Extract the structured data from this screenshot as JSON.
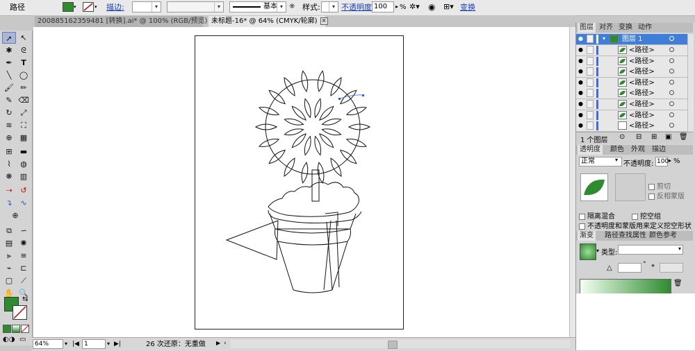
{
  "control_bar": {
    "object_type": "路径",
    "fill_color": "#2e8b2e",
    "stroke_label": "描边:",
    "stroke_profile_label": "基本",
    "style_label": "样式:",
    "opacity_label": "不透明度:",
    "opacity_value": "100",
    "percent": "%",
    "transform_label": "变换"
  },
  "tabs": [
    {
      "label": "200885162359481 [转换].ai* @ 100% (RGB/预览)",
      "active": false
    },
    {
      "label": "未标题-16* @ 64% (CMYK/轮廓)",
      "active": true
    }
  ],
  "status_bar": {
    "zoom": "64%",
    "artboard": "1",
    "undo_text": "26 次还原：无重做"
  },
  "panel_layers": {
    "tabs": [
      "图层",
      "对齐",
      "变换",
      "动作"
    ],
    "layer_name": "图层 1",
    "rows": [
      {
        "label": "<路径>"
      },
      {
        "label": "<路径>"
      },
      {
        "label": "<路径>"
      },
      {
        "label": "<路径>"
      },
      {
        "label": "<路径>"
      },
      {
        "label": "<路径>"
      },
      {
        "label": "<路径>"
      },
      {
        "label": "<路径>"
      }
    ],
    "count": "1 个图层"
  },
  "panel_transparency": {
    "tabs": [
      "透明度",
      "颜色",
      "外观",
      "描边"
    ],
    "blend_mode": "正常",
    "opacity_label": "不透明度:",
    "opacity_value": "100",
    "percent": "%",
    "clip_label": "剪切",
    "invert_label": "反相蒙版",
    "isolate_label": "隔离混合",
    "knockout_label": "挖空组",
    "opacity_mask_label": "不透明度和蒙版用来定义挖空形状"
  },
  "panel_gradient": {
    "tabs": [
      "渐变",
      "路径查找",
      "属性",
      "颜色参考"
    ],
    "type_label": "类型:",
    "angle_symbol": "°",
    "accent_green": "#2e8b2e"
  }
}
